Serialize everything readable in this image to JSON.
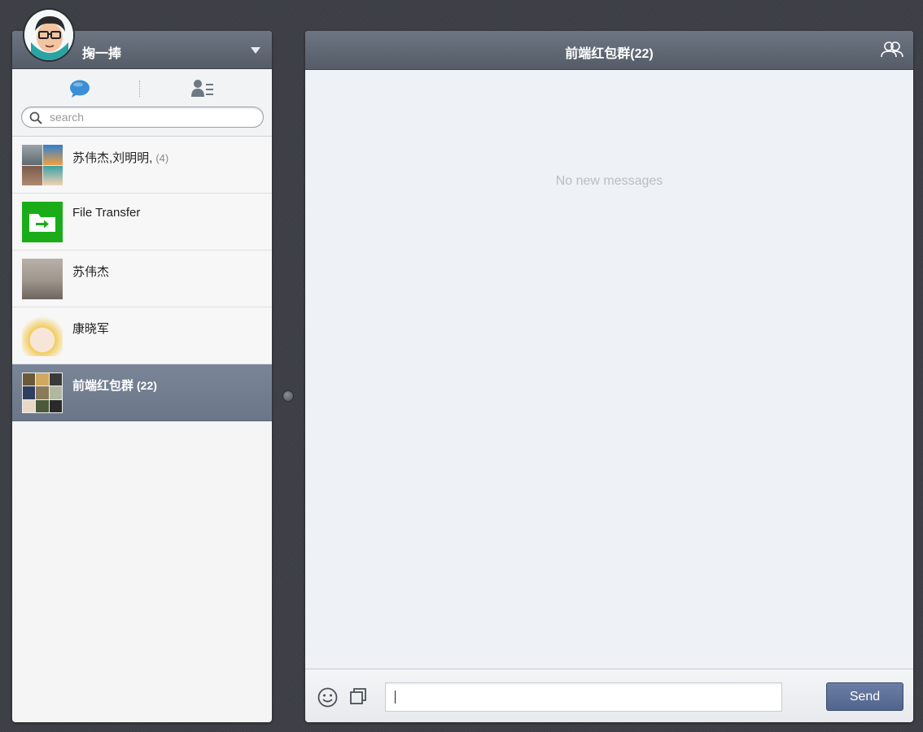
{
  "user": {
    "name": "掬一捧"
  },
  "search": {
    "placeholder": "search"
  },
  "conversations": [
    {
      "name": "苏伟杰,刘明明,",
      "count": "(4)"
    },
    {
      "name": "File Transfer",
      "count": ""
    },
    {
      "name": "苏伟杰",
      "count": ""
    },
    {
      "name": "康晓军",
      "count": ""
    },
    {
      "name": "前端红包群",
      "count": "(22)"
    }
  ],
  "chat": {
    "title": "前端红包群(22)",
    "empty_message": "No new messages",
    "input_value": "",
    "send_label": "Send"
  },
  "icons": {
    "dropdown": "chevron-down-icon",
    "chat_tab": "chat-bubble-icon",
    "contacts_tab": "contacts-icon",
    "search": "search-icon",
    "members": "group-members-icon",
    "emoji": "emoji-icon",
    "screenshot": "screenshot-icon",
    "file_transfer": "folder-arrow-icon"
  },
  "colors": {
    "header_bg": "#5e6772",
    "active_item_bg": "#737e91",
    "send_button_bg": "#5a6d96",
    "file_transfer_green": "#1aad19",
    "chat_tab_blue": "#3a8fd6"
  }
}
